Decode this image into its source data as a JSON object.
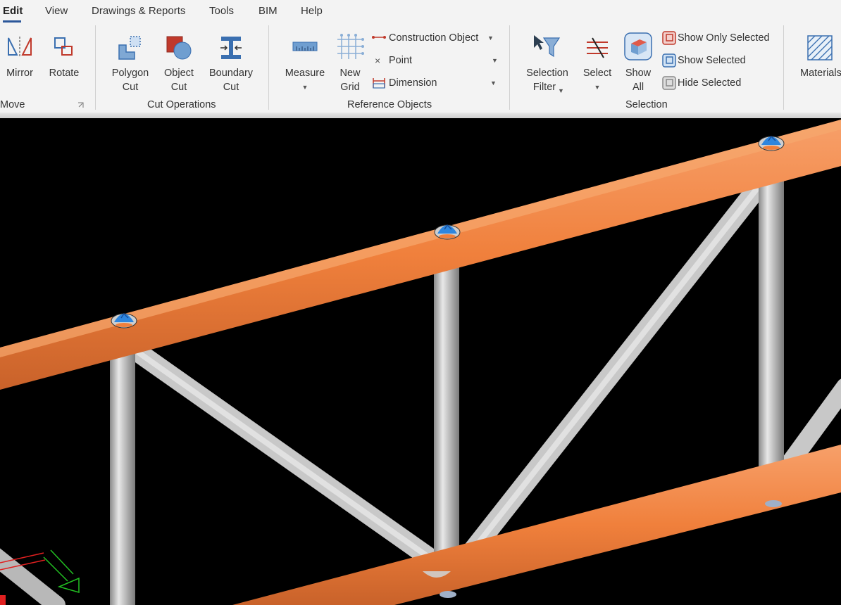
{
  "menu": {
    "tabs": [
      "Edit",
      "View",
      "Drawings & Reports",
      "Tools",
      "BIM",
      "Help"
    ],
    "active_tab": "Edit"
  },
  "ribbon": {
    "move": {
      "label": "Move",
      "mirror": "Mirror",
      "rotate": "Rotate"
    },
    "cut_operations": {
      "label": "Cut Operations",
      "polygon_cut": [
        "Polygon",
        "Cut"
      ],
      "object_cut": [
        "Object",
        "Cut"
      ],
      "boundary_cut": [
        "Boundary",
        "Cut"
      ]
    },
    "reference_objects": {
      "label": "Reference Objects",
      "measure": "Measure",
      "new_grid": [
        "New",
        "Grid"
      ],
      "construction_object": "Construction Object",
      "point": "Point",
      "dimension": "Dimension"
    },
    "selection": {
      "label": "Selection",
      "selection_filter": [
        "Selection",
        "Filter"
      ],
      "select": "Select",
      "show_all": [
        "Show",
        "All"
      ],
      "show_only_selected": "Show Only Selected",
      "show_selected": "Show Selected",
      "hide_selected": "Hide Selected"
    },
    "materials": {
      "label": "Materials"
    }
  },
  "colors": {
    "accent": "#2b579a",
    "chord": "#f0803c",
    "member": "#c8c8c8",
    "node": "#2e86de"
  }
}
